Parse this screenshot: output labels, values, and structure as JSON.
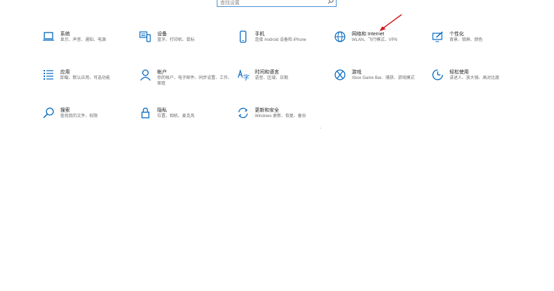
{
  "search": {
    "placeholder": "查找设置"
  },
  "accent_color": "#0067c0",
  "arrow_color": "#d0191e",
  "tiles": [
    {
      "title": "系统",
      "desc": "显示、声音、通知、电源",
      "icon": "laptop-icon"
    },
    {
      "title": "设备",
      "desc": "蓝牙、打印机、鼠标",
      "icon": "keyboard-icon"
    },
    {
      "title": "手机",
      "desc": "连接 Android 设备和 iPhone",
      "icon": "phone-icon"
    },
    {
      "title": "网络和 Internet",
      "desc": "WLAN、飞行模式、VPN",
      "icon": "globe-icon"
    },
    {
      "title": "个性化",
      "desc": "背景、锁屏、颜色",
      "icon": "paint-icon"
    },
    {
      "title": "应用",
      "desc": "卸载、默认应用、可选功能",
      "icon": "apps-list-icon"
    },
    {
      "title": "帐户",
      "desc": "你的帐户、电子邮件、同步设置、工作、家庭",
      "icon": "person-icon"
    },
    {
      "title": "时间和语言",
      "desc": "语音、区域、日期",
      "icon": "time-language-icon"
    },
    {
      "title": "游戏",
      "desc": "Xbox Game Bar、捕获、游戏模式",
      "icon": "xbox-icon"
    },
    {
      "title": "轻松使用",
      "desc": "讲述人、放大镜、高对比度",
      "icon": "ease-of-access-icon"
    },
    {
      "title": "搜索",
      "desc": "查找我的文件、权限",
      "icon": "search-icon"
    },
    {
      "title": "隐私",
      "desc": "位置、相机、麦克风",
      "icon": "lock-icon"
    },
    {
      "title": "更新和安全",
      "desc": "Windows 更新、恢复、备份",
      "icon": "sync-icon"
    }
  ]
}
